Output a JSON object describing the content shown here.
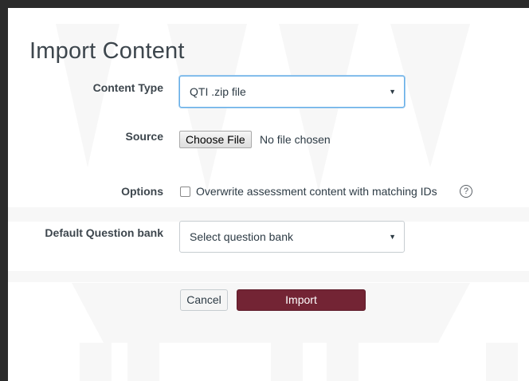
{
  "page": {
    "title": "Import Content"
  },
  "form": {
    "content_type": {
      "label": "Content Type",
      "value": "QTI .zip file"
    },
    "source": {
      "label": "Source",
      "button_label": "Choose File",
      "status": "No file chosen"
    },
    "options": {
      "label": "Options",
      "checkbox_label": "Overwrite assessment content with matching IDs",
      "checked": false,
      "help_icon": "?"
    },
    "question_bank": {
      "label": "Default Question bank",
      "value": "Select question bank"
    }
  },
  "actions": {
    "cancel_label": "Cancel",
    "import_label": "Import"
  },
  "icons": {
    "select_arrow": "▼",
    "help": "question-circle-icon"
  },
  "colors": {
    "accent": "#732434",
    "text": "#2d3b45",
    "focus_border": "#66afe9"
  }
}
